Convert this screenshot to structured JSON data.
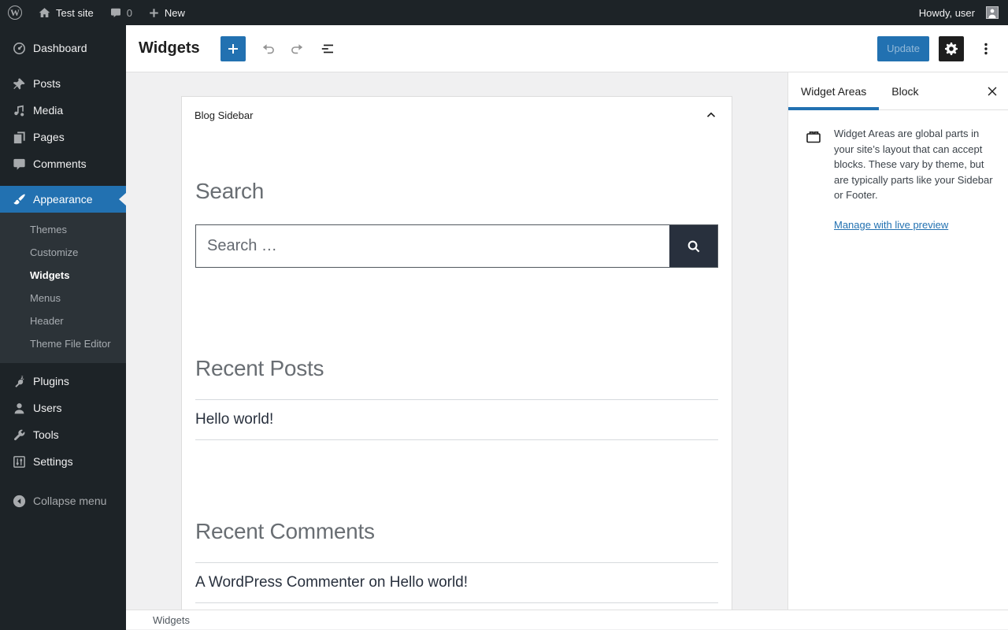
{
  "admin_bar": {
    "site_name": "Test site",
    "comments_count": "0",
    "new_label": "New",
    "howdy_text": "Howdy, user"
  },
  "sidebar": {
    "items": [
      {
        "label": "Dashboard"
      },
      {
        "label": "Posts"
      },
      {
        "label": "Media"
      },
      {
        "label": "Pages"
      },
      {
        "label": "Comments"
      },
      {
        "label": "Appearance"
      },
      {
        "label": "Plugins"
      },
      {
        "label": "Users"
      },
      {
        "label": "Tools"
      },
      {
        "label": "Settings"
      }
    ],
    "appearance_submenu": [
      {
        "label": "Themes"
      },
      {
        "label": "Customize"
      },
      {
        "label": "Widgets"
      },
      {
        "label": "Menus"
      },
      {
        "label": "Header"
      },
      {
        "label": "Theme File Editor"
      }
    ],
    "collapse_label": "Collapse menu"
  },
  "header": {
    "title": "Widgets",
    "update_label": "Update"
  },
  "canvas": {
    "widget_area_title": "Blog Sidebar",
    "search_heading": "Search",
    "search_placeholder": "Search …",
    "recent_posts_heading": "Recent Posts",
    "recent_post_title": "Hello world!",
    "recent_comments_heading": "Recent Comments",
    "comment_author": "A WordPress Commenter",
    "comment_connector": " on ",
    "comment_post": "Hello world!"
  },
  "panel": {
    "tab_widget_areas": "Widget Areas",
    "tab_block": "Block",
    "description": "Widget Areas are global parts in your site’s layout that can accept blocks. These vary by theme, but are typically parts like your Sidebar or Footer.",
    "manage_link": "Manage with live preview"
  },
  "footer": {
    "breadcrumb": "Widgets"
  },
  "colors": {
    "admin_accent": "#2271b1",
    "admin_dark": "#1d2327",
    "theme_dark": "#28303d"
  }
}
